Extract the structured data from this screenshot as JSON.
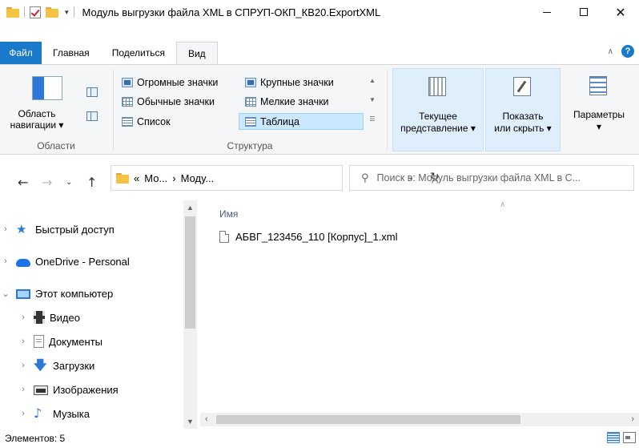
{
  "window": {
    "title": "Модуль выгрузки файла XML в СПРУП-ОКП_КВ20.ExportXML",
    "qa_arrow": "▾"
  },
  "ribbon": {
    "tabs": [
      "Файл",
      "Главная",
      "Поделиться",
      "Вид"
    ],
    "help": "?",
    "groups": {
      "panes": {
        "label": "Области",
        "nav_pane_label_1": "Область",
        "nav_pane_label_2": "навигации ▾"
      },
      "layout": {
        "label": "Структура",
        "items": [
          "Огромные значки",
          "Крупные значки",
          "Обычные значки",
          "Мелкие значки",
          "Список",
          "Таблица"
        ]
      },
      "current_view": {
        "label_1": "Текущее",
        "label_2": "представление ▾"
      },
      "show_hide": {
        "label_1": "Показать",
        "label_2": "или скрыть ▾"
      },
      "options": {
        "label_1": "Параметры",
        "label_2": "▾"
      }
    }
  },
  "address": {
    "crumbs": [
      "«",
      "Мо...",
      "›",
      "Моду..."
    ],
    "search_placeholder": "Поиск в: Модуль выгрузки файла XML в С..."
  },
  "navpane": {
    "items": [
      {
        "label": "Быстрый доступ",
        "expander": "›",
        "icon": "star-icon"
      },
      {
        "label": "OneDrive - Personal",
        "expander": "›",
        "icon": "cloud-icon"
      },
      {
        "label": "Этот компьютер",
        "expander": "⌄",
        "icon": "computer-icon"
      },
      {
        "label": "Видео",
        "expander": "›",
        "icon": "video-icon"
      },
      {
        "label": "Документы",
        "expander": "›",
        "icon": "documents-icon"
      },
      {
        "label": "Загрузки",
        "expander": "›",
        "icon": "downloads-icon"
      },
      {
        "label": "Изображения",
        "expander": "›",
        "icon": "images-icon"
      },
      {
        "label": "Музыка",
        "expander": "›",
        "icon": "music-icon"
      }
    ]
  },
  "content": {
    "column_name": "Имя",
    "files": [
      "АБВГ_123456_110 [Корпус]_1.xml"
    ]
  },
  "status": {
    "items_count": "Элементов: 5"
  },
  "colors": {
    "accent": "#1979ca",
    "selection": "#cce8ff",
    "ribbon_bg": "#f5f6f7"
  }
}
